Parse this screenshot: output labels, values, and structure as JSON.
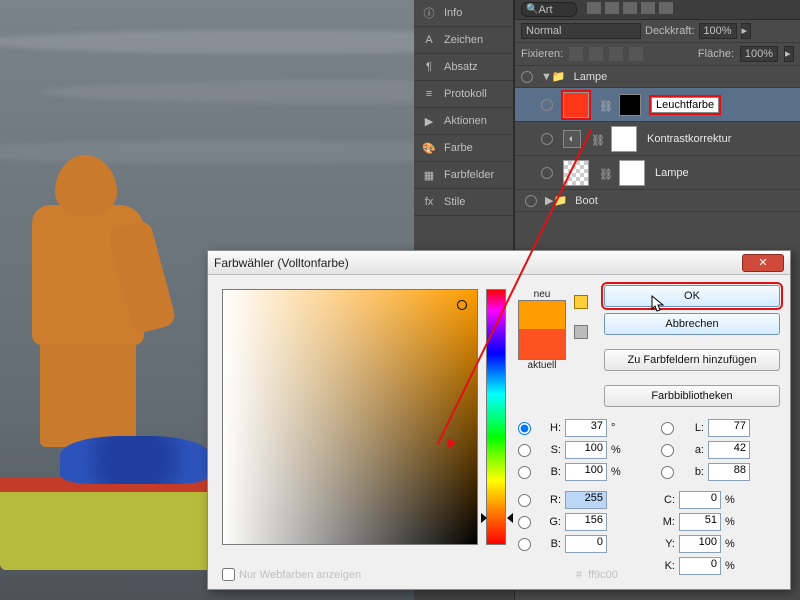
{
  "panels": {
    "info": "Info",
    "zeichen": "Zeichen",
    "absatz": "Absatz",
    "protokoll": "Protokoll",
    "aktionen": "Aktionen",
    "farbe": "Farbe",
    "farbfelder": "Farbfelder",
    "stile": "Stile"
  },
  "layers": {
    "search_placeholder": "Art",
    "blend_mode": "Normal",
    "deckkraft_label": "Deckkraft:",
    "deckkraft_value": "100%",
    "fixieren_label": "Fixieren:",
    "flaeche_label": "Fläche:",
    "flaeche_value": "100%",
    "group_lampe": "Lampe",
    "items": [
      {
        "name": "Leuchtfarbe",
        "editing": true,
        "thumb": "red",
        "has_mask": true,
        "highlighted": true
      },
      {
        "name": "Kontrastkorrektur",
        "editing": false,
        "thumb": "white",
        "has_mask": true
      },
      {
        "name": "Lampe",
        "editing": false,
        "thumb": "white",
        "has_mask": true
      },
      {
        "name": "Boot",
        "editing": false,
        "thumb": "none",
        "group": true
      }
    ]
  },
  "dialog": {
    "title": "Farbwähler (Volltonfarbe)",
    "neu_label": "neu",
    "aktuell_label": "aktuell",
    "ok": "OK",
    "cancel": "Abbrechen",
    "add_swatch": "Zu Farbfeldern hinzufügen",
    "libraries": "Farbbibliotheken",
    "web_only": "Nur Webfarben anzeigen",
    "hex_label": "#",
    "hex_value": "ff9c00",
    "hsb": {
      "H": "37",
      "S": "100",
      "B": "100"
    },
    "rgb": {
      "R": "255",
      "G": "156",
      "B": "0"
    },
    "lab": {
      "L": "77",
      "a": "42",
      "b": "88"
    },
    "cmyk": {
      "C": "0",
      "M": "51",
      "Y": "100",
      "K": "0"
    },
    "radio_selected": "H",
    "input_selected": "R",
    "values": {
      "deg": "°",
      "pct": "%"
    }
  }
}
